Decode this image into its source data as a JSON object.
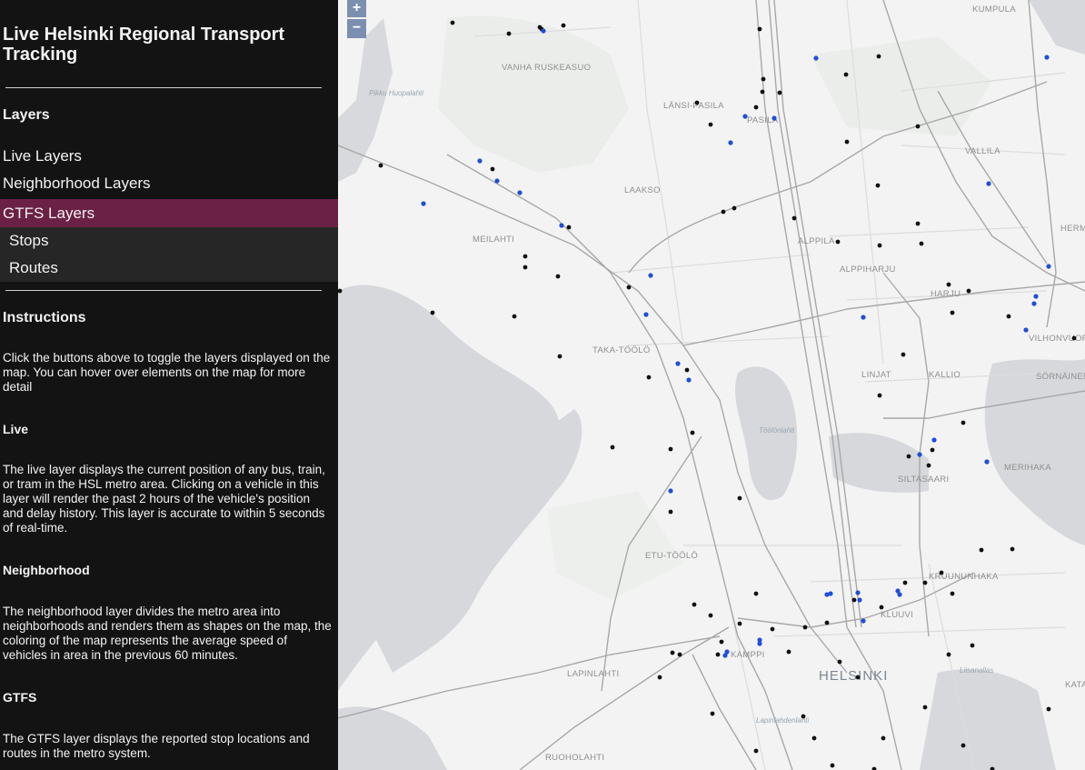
{
  "sidebar": {
    "title": "Live Helsinki Regional Transport Tracking",
    "layers_heading": "Layers",
    "nav": {
      "live": "Live Layers",
      "neighborhood": "Neighborhood Layers",
      "gtfs": "GTFS Layers",
      "stops": "Stops",
      "routes": "Routes"
    },
    "instructions_heading": "Instructions",
    "instructions_text": "Click the buttons above to toggle the layers displayed on the map. You can hover over elements on the map for more detail",
    "live_heading": "Live",
    "live_text": "The live layer displays the current position of any bus, train, or tram in the HSL metro area. Clicking on a vehicle in this layer will render the past 2 hours of the vehicle's position and delay history. This layer is accurate to within 5 seconds of real-time.",
    "neighborhood_heading": "Neighborhood",
    "neighborhood_text": "The neighborhood layer divides the metro area into neighborhoods and renders them as shapes on the map, the coloring of the map represents the average speed of vehicles in area in the previous 60 minutes.",
    "gtfs_heading": "GTFS",
    "gtfs_text": "The GTFS layer displays the reported stop locations and routes in the metro system."
  },
  "map": {
    "zoom_in": "+",
    "zoom_out": "−",
    "labels": {
      "kumpula": "KUMPULA",
      "vanha_ruskeasuo": "VANHA RUSKEASUO",
      "lansi_pasila": "LÄNSI-PASILA",
      "pasila": "PASILA",
      "vallila": "VALLILA",
      "laakso": "LAAKSO",
      "hermanni": "HERMA",
      "meilahti": "MEILAHTI",
      "alppila": "ALPPILA",
      "alppiharju": "ALPPIHARJU",
      "harju": "HARJU",
      "vilhonvuori": "VILHONVUORI",
      "taka_toolo": "TAKA-TÖÖLÖ",
      "linjat": "LINJAT",
      "kallio": "KALLIO",
      "sornainen": "SÖRNÄINEN",
      "toolonlahti": "Töölönlahti",
      "siltasaari": "SILTASAARI",
      "merihaka": "MERIHAKA",
      "etu_toolo": "ETU-TÖÖLÖ",
      "kruununhaka": "KRUUNUNHAKA",
      "kluuvi": "KLUUVI",
      "kamppi": "KAMPPI",
      "lapinlahti": "LAPINLAHTI",
      "helsinki": "HELSINKI",
      "katajanokka": "KATAJ",
      "ruoholahti": "RUOHOLAHTI",
      "pikku_huopalahti": "Pikku Huopalahti",
      "lapinlahdenlahti": "Lapinlahdenlahti",
      "linnanallas": "Liisanallas"
    },
    "colors": {
      "water": "#d6d8db",
      "land": "#f3f3f3",
      "park": "#e9ebe9",
      "road_major": "#a9a9a9",
      "road_minor": "#d9d9d9",
      "stop": "#111111",
      "vehicle": "#1f4fd6"
    }
  }
}
